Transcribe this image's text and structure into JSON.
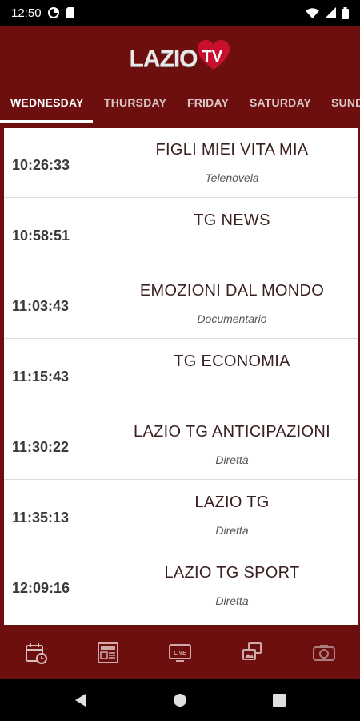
{
  "status_bar": {
    "time": "12:50",
    "icons": [
      "data-saver-icon",
      "sim-card-icon",
      "wifi-icon",
      "signal-icon",
      "battery-icon"
    ]
  },
  "header": {
    "logo_text": "LAZIO",
    "logo_badge": "TV",
    "brand_color": "#6e0f0f",
    "accent_color": "#c8102e"
  },
  "tabs": [
    {
      "label": "WEDNESDAY",
      "active": true
    },
    {
      "label": "THURSDAY",
      "active": false
    },
    {
      "label": "FRIDAY",
      "active": false
    },
    {
      "label": "SATURDAY",
      "active": false
    },
    {
      "label": "SUND",
      "active": false
    }
  ],
  "schedule": [
    {
      "time": "10:26:33",
      "title": "FIGLI MIEI VITA MIA",
      "genre": "Telenovela"
    },
    {
      "time": "10:58:51",
      "title": "TG NEWS",
      "genre": ""
    },
    {
      "time": "11:03:43",
      "title": "EMOZIONI DAL MONDO",
      "genre": "Documentario"
    },
    {
      "time": "11:15:43",
      "title": "TG ECONOMIA",
      "genre": ""
    },
    {
      "time": "11:30:22",
      "title": "LAZIO TG ANTICIPAZIONI",
      "genre": "Diretta"
    },
    {
      "time": "11:35:13",
      "title": "LAZIO TG",
      "genre": "Diretta"
    },
    {
      "time": "12:09:16",
      "title": "LAZIO TG SPORT",
      "genre": "Diretta"
    }
  ],
  "bottom_nav": [
    {
      "icon": "calendar-schedule-icon",
      "active": true
    },
    {
      "icon": "news-icon",
      "active": false
    },
    {
      "icon": "live-tv-icon",
      "active": false
    },
    {
      "icon": "gallery-icon",
      "active": false
    },
    {
      "icon": "camera-icon",
      "active": false
    }
  ],
  "system_nav": [
    "back-icon",
    "home-icon",
    "recents-icon"
  ]
}
